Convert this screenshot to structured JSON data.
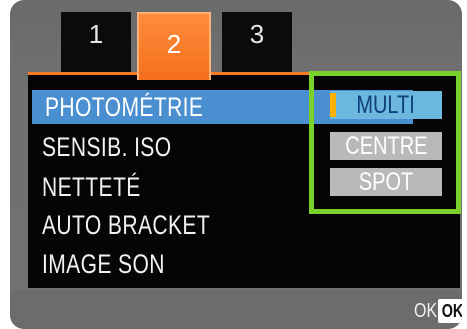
{
  "tabs": [
    {
      "label": "1",
      "active": false
    },
    {
      "label": "2",
      "active": true
    },
    {
      "label": "3",
      "active": false
    }
  ],
  "menu": {
    "items": [
      {
        "label": "PHOTOMÉTRIE",
        "selected": true
      },
      {
        "label": "SENSIB. ISO",
        "selected": false
      },
      {
        "label": "NETTETÉ",
        "selected": false
      },
      {
        "label": "AUTO BRACKET",
        "selected": false
      },
      {
        "label": "IMAGE SON",
        "selected": false
      }
    ]
  },
  "options": [
    {
      "label": "MULTI",
      "selected": true
    },
    {
      "label": "CENTRE",
      "selected": false
    },
    {
      "label": "SPOT",
      "selected": false
    }
  ],
  "footer": {
    "ok_label": "OK",
    "ok_button": "OK"
  },
  "colors": {
    "active_tab": "#f46f1e",
    "selected_row": "#4a8fd0",
    "highlight_frame": "#7ad12a",
    "selected_option": "#6bb7de",
    "unselected_option": "#b9b9b9"
  }
}
